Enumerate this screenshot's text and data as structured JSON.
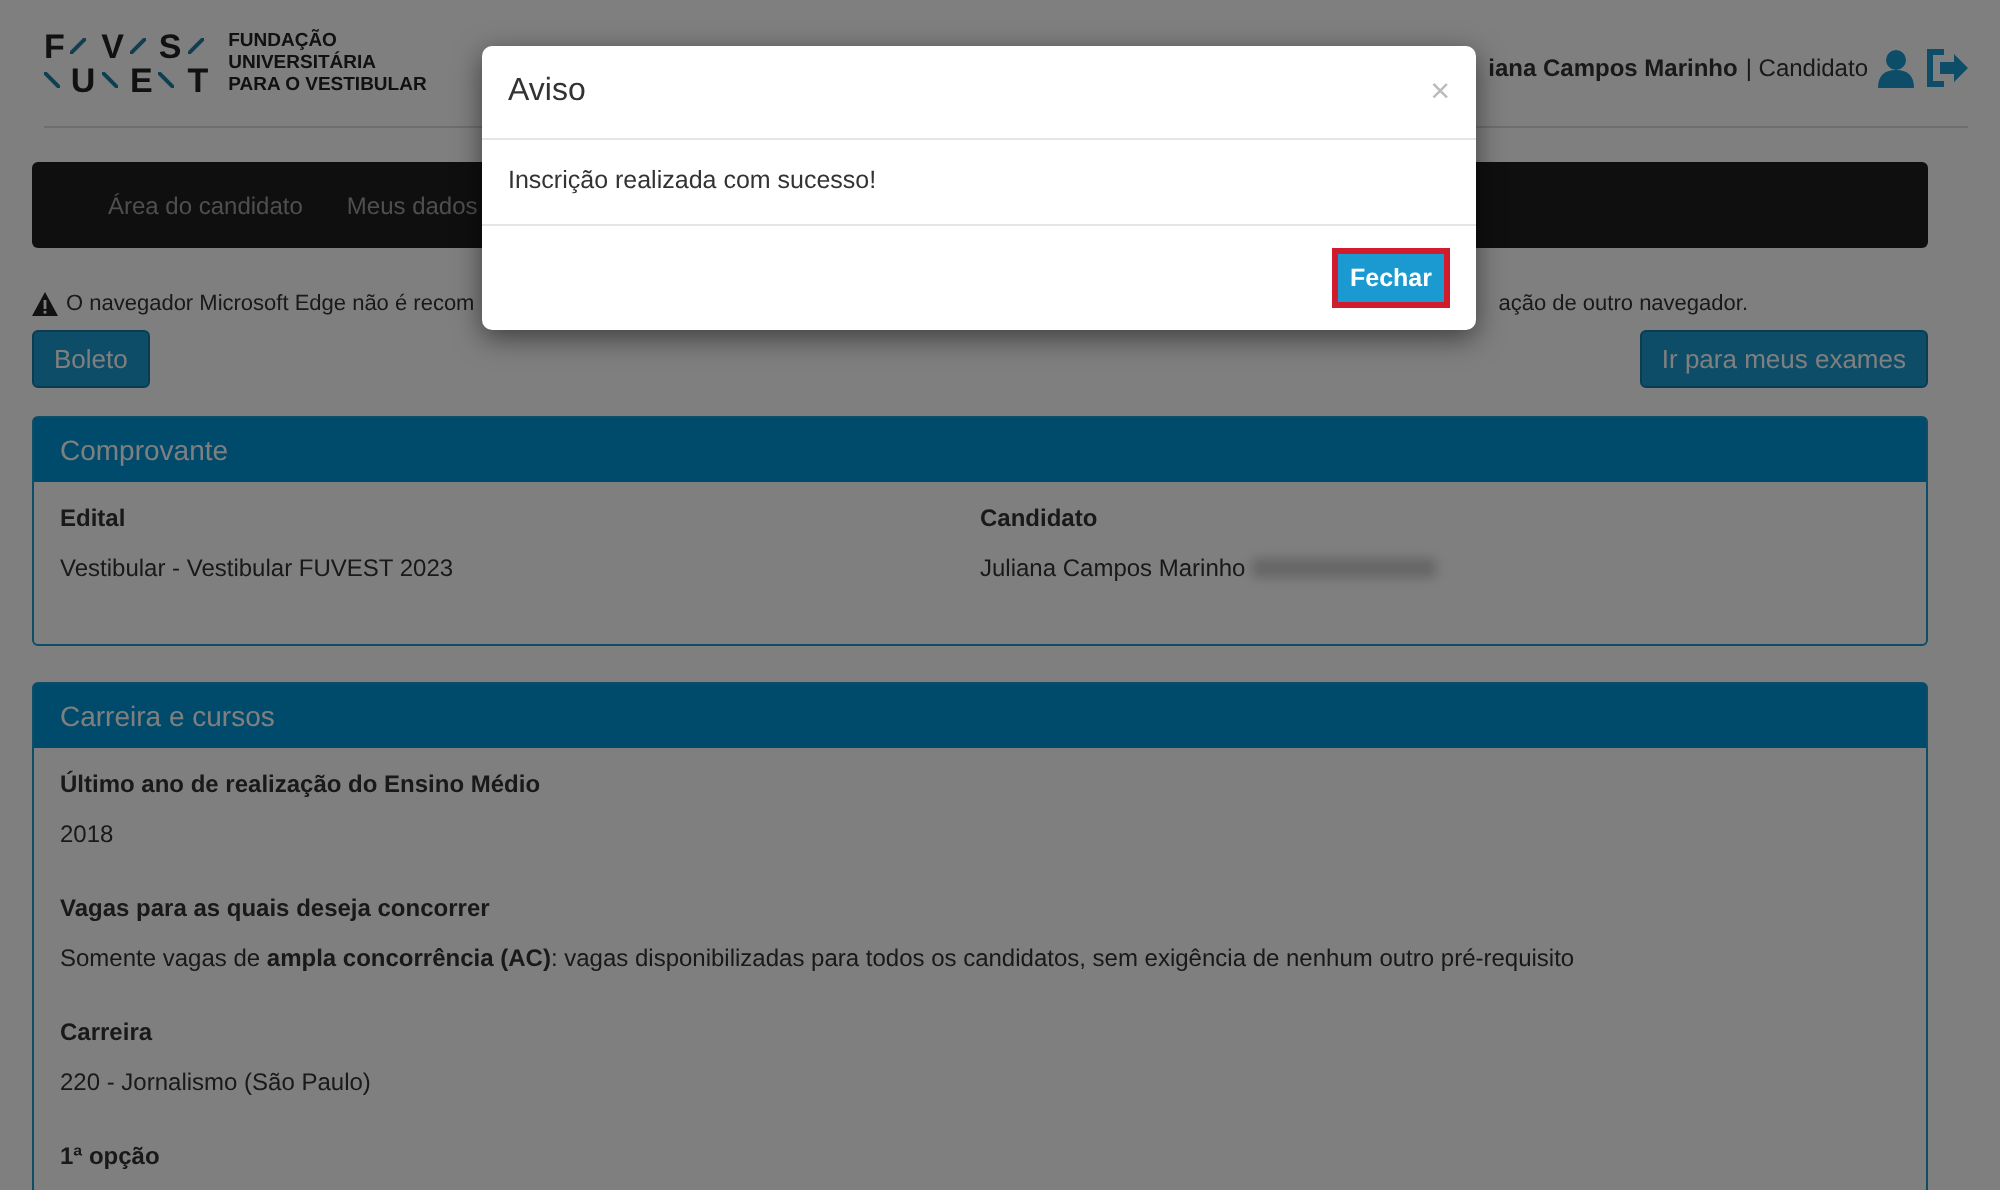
{
  "header": {
    "logo": {
      "top_letters": [
        "F",
        "V",
        "S"
      ],
      "bottom_letters": [
        "U",
        "E",
        "T"
      ],
      "name_lines": [
        "FUNDAÇÃO",
        "UNIVERSITÁRIA",
        "PARA O VESTIBULAR"
      ]
    },
    "user_name": "iana Campos Marinho",
    "user_role": "| Candidato"
  },
  "nav": {
    "items": [
      {
        "label": "Área do candidato",
        "selected": false
      },
      {
        "label": "Meus dados",
        "selected": false
      }
    ]
  },
  "warning": {
    "left_text": "O navegador Microsoft Edge não é recom",
    "right_text": "ação de outro navegador."
  },
  "actions": [
    "Boleto",
    "Ir para meus exames"
  ],
  "panels": [
    {
      "title": "Comprovante",
      "kind": "columns",
      "fields": [
        {
          "label": "Edital",
          "value": "Vestibular - Vestibular FUVEST 2023"
        },
        {
          "label": "Candidato",
          "value": "Juliana Campos Marinho",
          "redacted": true
        }
      ]
    },
    {
      "title": "Carreira e cursos",
      "kind": "stack",
      "fields": [
        {
          "label": "Último ano de realização do Ensino Médio",
          "value": "2018"
        },
        {
          "label": "Vagas para as quais deseja concorrer",
          "value": "Somente vagas de **ampla concorrência (AC)**: vagas disponibilizadas para todos os candidatos, sem exigência de nenhum outro pré-requisito"
        },
        {
          "label": "Carreira",
          "value": "220 - Jornalismo (São Paulo)"
        },
        {
          "label": "1ª opção"
        }
      ]
    }
  ],
  "modal": {
    "title": "Aviso",
    "close": "×",
    "message": "Inscrição realizada com sucesso!",
    "button": {
      "label": "Fechar",
      "highlighted": true
    }
  }
}
